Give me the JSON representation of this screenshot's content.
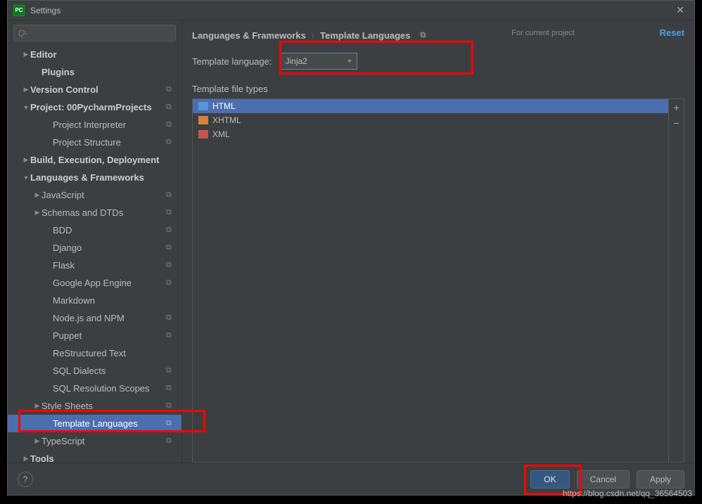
{
  "window": {
    "title": "Settings"
  },
  "search": {
    "placeholder": "Q-"
  },
  "sidebar": {
    "items": [
      {
        "label": "Editor",
        "arrow": "▶",
        "bold": true,
        "indent": 1
      },
      {
        "label": "Plugins",
        "arrow": "",
        "bold": true,
        "indent": 2
      },
      {
        "label": "Version Control",
        "arrow": "▶",
        "bold": true,
        "indent": 1,
        "copy": true
      },
      {
        "label": "Project: 00PycharmProjects",
        "arrow": "▼",
        "bold": true,
        "indent": 1,
        "copy": true
      },
      {
        "label": "Project Interpreter",
        "arrow": "",
        "bold": false,
        "indent": 3,
        "copy": true
      },
      {
        "label": "Project Structure",
        "arrow": "",
        "bold": false,
        "indent": 3,
        "copy": true
      },
      {
        "label": "Build, Execution, Deployment",
        "arrow": "▶",
        "bold": true,
        "indent": 1
      },
      {
        "label": "Languages & Frameworks",
        "arrow": "▼",
        "bold": true,
        "indent": 1
      },
      {
        "label": "JavaScript",
        "arrow": "▶",
        "bold": false,
        "indent": 2,
        "copy": true
      },
      {
        "label": "Schemas and DTDs",
        "arrow": "▶",
        "bold": false,
        "indent": 2,
        "copy": true
      },
      {
        "label": "BDD",
        "arrow": "",
        "bold": false,
        "indent": 3,
        "copy": true
      },
      {
        "label": "Django",
        "arrow": "",
        "bold": false,
        "indent": 3,
        "copy": true
      },
      {
        "label": "Flask",
        "arrow": "",
        "bold": false,
        "indent": 3,
        "copy": true
      },
      {
        "label": "Google App Engine",
        "arrow": "",
        "bold": false,
        "indent": 3,
        "copy": true
      },
      {
        "label": "Markdown",
        "arrow": "",
        "bold": false,
        "indent": 3
      },
      {
        "label": "Node.js and NPM",
        "arrow": "",
        "bold": false,
        "indent": 3,
        "copy": true
      },
      {
        "label": "Puppet",
        "arrow": "",
        "bold": false,
        "indent": 3,
        "copy": true
      },
      {
        "label": "ReStructured Text",
        "arrow": "",
        "bold": false,
        "indent": 3
      },
      {
        "label": "SQL Dialects",
        "arrow": "",
        "bold": false,
        "indent": 3,
        "copy": true
      },
      {
        "label": "SQL Resolution Scopes",
        "arrow": "",
        "bold": false,
        "indent": 3,
        "copy": true
      },
      {
        "label": "Style Sheets",
        "arrow": "▶",
        "bold": false,
        "indent": 2,
        "copy": true
      },
      {
        "label": "Template Languages",
        "arrow": "",
        "bold": false,
        "indent": 3,
        "copy": true,
        "selected": true
      },
      {
        "label": "TypeScript",
        "arrow": "▶",
        "bold": false,
        "indent": 2,
        "copy": true
      },
      {
        "label": "Tools",
        "arrow": "▶",
        "bold": true,
        "indent": 1
      }
    ]
  },
  "main": {
    "breadcrumb": {
      "a": "Languages & Frameworks",
      "sep": "›",
      "b": "Template Languages"
    },
    "projectBadge": "For current project",
    "reset": "Reset",
    "formLabel": "Template language:",
    "comboValue": "Jinja2",
    "sectionLabel": "Template file types",
    "files": [
      {
        "label": "HTML",
        "icon": "html",
        "sel": true
      },
      {
        "label": "XHTML",
        "icon": "xhtml"
      },
      {
        "label": "XML",
        "icon": "xml"
      }
    ],
    "add": "+",
    "remove": "−"
  },
  "footer": {
    "help": "?",
    "ok": "OK",
    "cancel": "Cancel",
    "apply": "Apply"
  },
  "watermark": "https://blog.csdn.net/qq_36564503"
}
